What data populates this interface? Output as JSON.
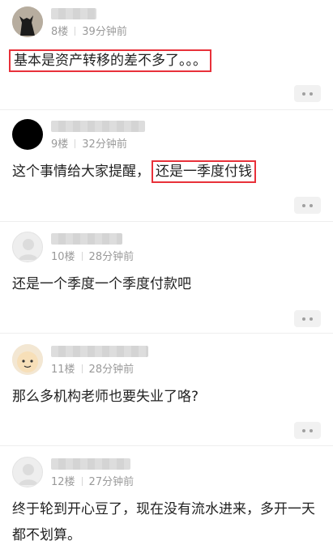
{
  "comments": [
    {
      "floor": "8楼",
      "time": "39分钟前",
      "text": "",
      "highlight": "基本是资产转移的差不多了。。。"
    },
    {
      "floor": "9楼",
      "time": "32分钟前",
      "text": "这个事情给大家提醒，",
      "highlight": "还是一季度付钱"
    },
    {
      "floor": "10楼",
      "time": "28分钟前",
      "text": "还是一个季度一个季度付款吧",
      "highlight": ""
    },
    {
      "floor": "11楼",
      "time": "28分钟前",
      "text": "那么多机构老师也要失业了咯?",
      "highlight": ""
    },
    {
      "floor": "12楼",
      "time": "27分钟前",
      "text": "终于轮到开心豆了，现在没有流水进来，多开一天都不划算。",
      "highlight": ""
    }
  ],
  "icons": {
    "more": "more-dots-icon",
    "avatar": "avatar"
  },
  "colors": {
    "highlight_border": "#e8313a",
    "meta_text": "#9a9a9a"
  }
}
